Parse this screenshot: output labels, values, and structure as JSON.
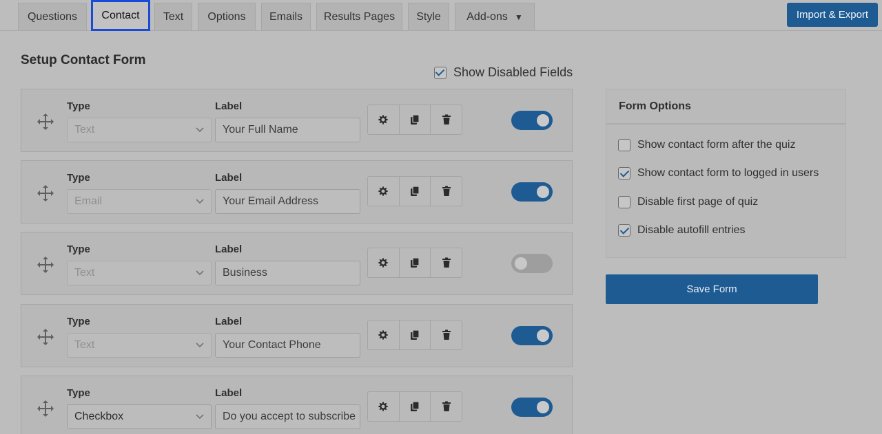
{
  "tabs": [
    {
      "label": "Questions"
    },
    {
      "label": "Contact",
      "active": true
    },
    {
      "label": "Text"
    },
    {
      "label": "Options"
    },
    {
      "label": "Emails"
    },
    {
      "label": "Results Pages"
    },
    {
      "label": "Style"
    },
    {
      "label": "Add-ons"
    }
  ],
  "header": {
    "import_export_label": "Import & Export"
  },
  "page": {
    "title": "Setup Contact Form",
    "show_disabled_label": "Show Disabled Fields",
    "show_disabled_checked": true
  },
  "field_headers": {
    "type": "Type",
    "label": "Label"
  },
  "fields": [
    {
      "type": "Text",
      "label": "Your Full Name",
      "enabled": true
    },
    {
      "type": "Email",
      "label": "Your Email Address",
      "enabled": true
    },
    {
      "type": "Text",
      "label": "Business",
      "enabled": false
    },
    {
      "type": "Text",
      "label": "Your Contact Phone",
      "enabled": true
    },
    {
      "type": "Checkbox",
      "label": "Do you accept to subscribe",
      "enabled": true
    }
  ],
  "form_options": {
    "title": "Form Options",
    "items": [
      {
        "label": "Show contact form after the quiz",
        "checked": false
      },
      {
        "label": "Show contact form to logged in users",
        "checked": true
      },
      {
        "label": "Disable first page of quiz",
        "checked": false
      },
      {
        "label": "Disable autofill entries",
        "checked": true
      }
    ],
    "save_label": "Save Form"
  },
  "colors": {
    "accent": "#1f5b93",
    "active_tab_outline": "#1a4bd6",
    "background": "#bdbdbd"
  },
  "icons": [
    "move-icon",
    "gear-icon",
    "duplicate-icon",
    "trash-icon",
    "chevron-down-icon",
    "caret-down-icon"
  ]
}
